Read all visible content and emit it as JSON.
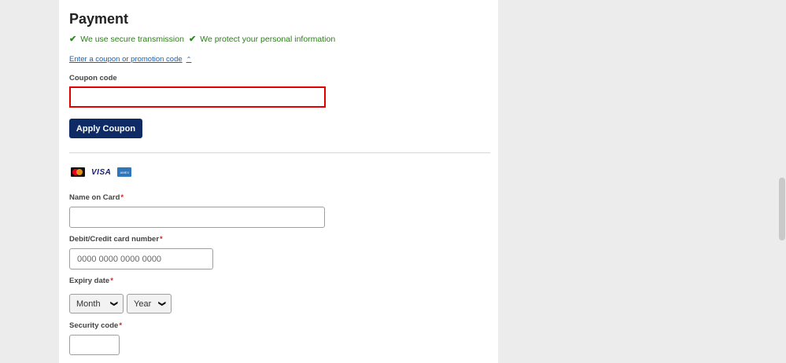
{
  "payment": {
    "title": "Payment",
    "assurances": [
      "We use secure transmission",
      "We protect your personal information"
    ],
    "coupon_link": "Enter a coupon or promotion code",
    "coupon_label": "Coupon code",
    "coupon_value": "",
    "apply_button": "Apply Coupon",
    "card_brands": [
      "mastercard-icon",
      "visa-icon",
      "amex-icon"
    ],
    "visa_text": "VISA",
    "amex_text": "AMEX",
    "name_label": "Name on Card",
    "name_value": "",
    "card_number_label": "Debit/Credit card number",
    "card_number_placeholder": "0000 0000 0000 0000",
    "expiry_label": "Expiry date",
    "month_selected": "Month",
    "year_selected": "Year",
    "security_label": "Security code",
    "security_value": "",
    "required_marker": "*"
  },
  "colors": {
    "primary_button": "#0f2b66",
    "link": "#1a5fb4",
    "assurance_green": "#2e7d1b",
    "highlight_border": "#e00000",
    "required": "#c62828"
  }
}
